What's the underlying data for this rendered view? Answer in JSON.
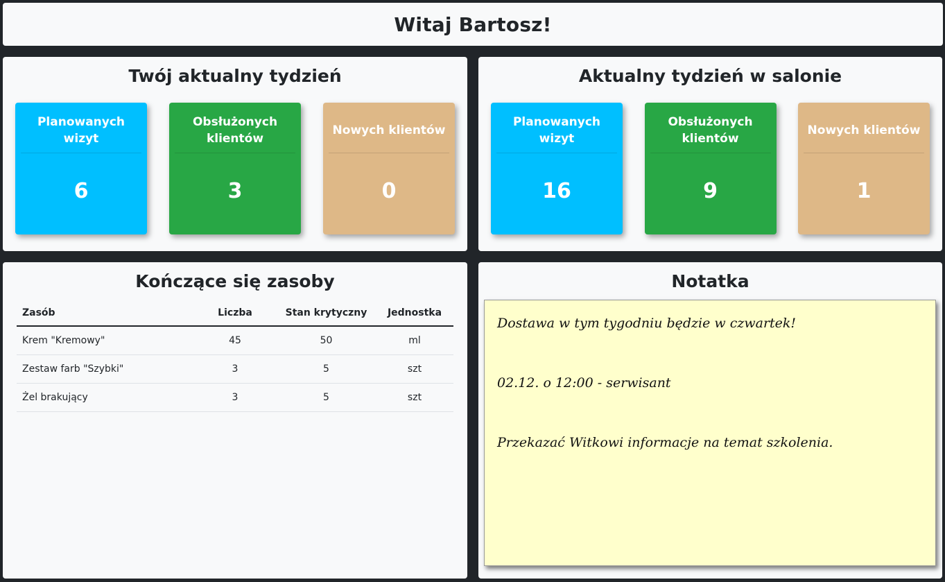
{
  "header": {
    "greeting": "Witaj Bartosz!"
  },
  "my_week": {
    "title": "Twój aktualny tydzień",
    "cards": [
      {
        "label": "Planowanych wizyt",
        "value": "6",
        "color": "#00bfff"
      },
      {
        "label": "Obsłużonych klientów",
        "value": "3",
        "color": "#28a745"
      },
      {
        "label": "Nowych klientów",
        "value": "0",
        "color": "#deb887"
      }
    ]
  },
  "salon_week": {
    "title": "Aktualny tydzień w salonie",
    "cards": [
      {
        "label": "Planowanych wizyt",
        "value": "16",
        "color": "#00bfff"
      },
      {
        "label": "Obsłużonych klientów",
        "value": "9",
        "color": "#28a745"
      },
      {
        "label": "Nowych klientów",
        "value": "1",
        "color": "#deb887"
      }
    ]
  },
  "resources": {
    "title": "Kończące się zasoby",
    "columns": [
      "Zasób",
      "Liczba",
      "Stan krytyczny",
      "Jednostka"
    ],
    "rows": [
      [
        "Krem \"Kremowy\"",
        "45",
        "50",
        "ml"
      ],
      [
        "Zestaw farb \"Szybki\"",
        "3",
        "5",
        "szt"
      ],
      [
        "Żel brakujący",
        "3",
        "5",
        "szt"
      ]
    ]
  },
  "note": {
    "title": "Notatka",
    "lines": [
      "Dostawa w tym tygodniu będzie w czwartek!",
      "02.12. o 12:00 - serwisant",
      "Przekazać Witkowi informacje na temat szkolenia."
    ]
  }
}
